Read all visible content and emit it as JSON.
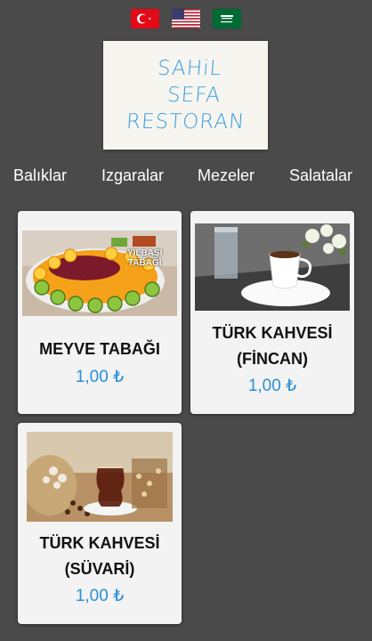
{
  "languages": [
    {
      "name": "turkish-flag-icon"
    },
    {
      "name": "usa-flag-icon"
    },
    {
      "name": "saudi-flag-icon"
    }
  ],
  "logo": {
    "line1": "SAHiL",
    "line2": "SEFA",
    "line3": "RESTORAN"
  },
  "categories": [
    "Balıklar",
    "Izgaralar",
    "Mezeler",
    "Salatalar"
  ],
  "products": [
    {
      "name_line1": "MEYVE TABAĞI",
      "name_line2": "",
      "price": "1,00 ₺",
      "image_text_1": "YILBAŞI",
      "image_text_2": "TABAĞI"
    },
    {
      "name_line1": "TÜRK KAHVESİ",
      "name_line2": "(FİNCAN)",
      "price": "1,00 ₺"
    },
    {
      "name_line1": "TÜRK KAHVESİ",
      "name_line2": "(SÜVARİ)",
      "price": "1,00 ₺"
    }
  ],
  "colors": {
    "background": "#4a4a4a",
    "accent": "#2a8fd6",
    "card": "#f3f3f3",
    "logo_text": "#3a9fe0"
  }
}
